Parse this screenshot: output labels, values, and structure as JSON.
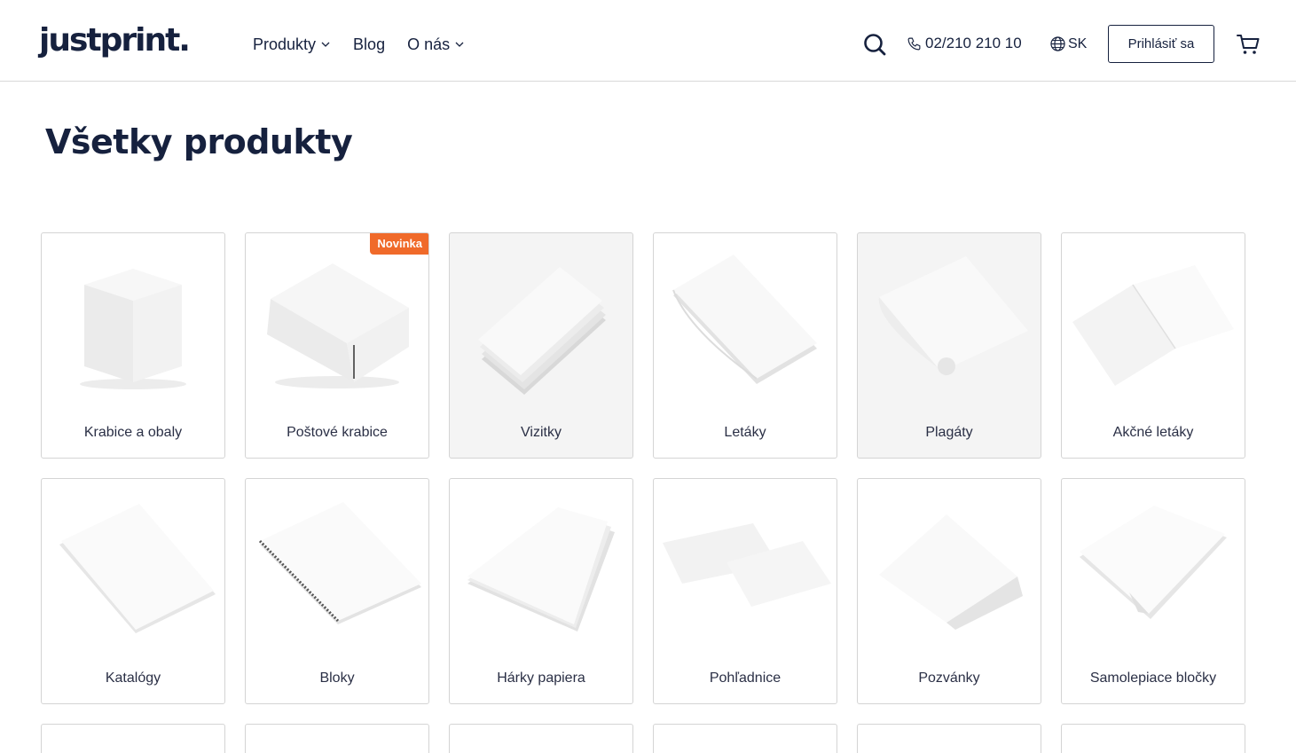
{
  "header": {
    "logo": "justprint.",
    "nav": [
      {
        "label": "Produkty",
        "has_dropdown": true
      },
      {
        "label": "Blog",
        "has_dropdown": false
      },
      {
        "label": "O nás",
        "has_dropdown": true
      }
    ],
    "phone": "02/210 210 10",
    "language": "SK",
    "login_label": "Prihlásiť sa",
    "icons": {
      "search": "search-icon",
      "phone": "phone-icon",
      "language": "globe-icon",
      "cart": "cart-icon"
    }
  },
  "page": {
    "title": "Všetky produkty"
  },
  "colors": {
    "text": "#16213e",
    "badge": "#f06a2a",
    "border": "#d4d4d4"
  },
  "products": [
    {
      "label": "Krabice a obaly",
      "badge": null
    },
    {
      "label": "Poštové krabice",
      "badge": "Novinka"
    },
    {
      "label": "Vizitky",
      "badge": null
    },
    {
      "label": "Letáky",
      "badge": null
    },
    {
      "label": "Plagáty",
      "badge": null
    },
    {
      "label": "Akčné letáky",
      "badge": null
    },
    {
      "label": "Katalógy",
      "badge": null
    },
    {
      "label": "Bloky",
      "badge": null
    },
    {
      "label": "Hárky papiera",
      "badge": null
    },
    {
      "label": "Pohľadnice",
      "badge": null
    },
    {
      "label": "Pozvánky",
      "badge": null
    },
    {
      "label": "Samolepiace bločky",
      "badge": null
    }
  ]
}
